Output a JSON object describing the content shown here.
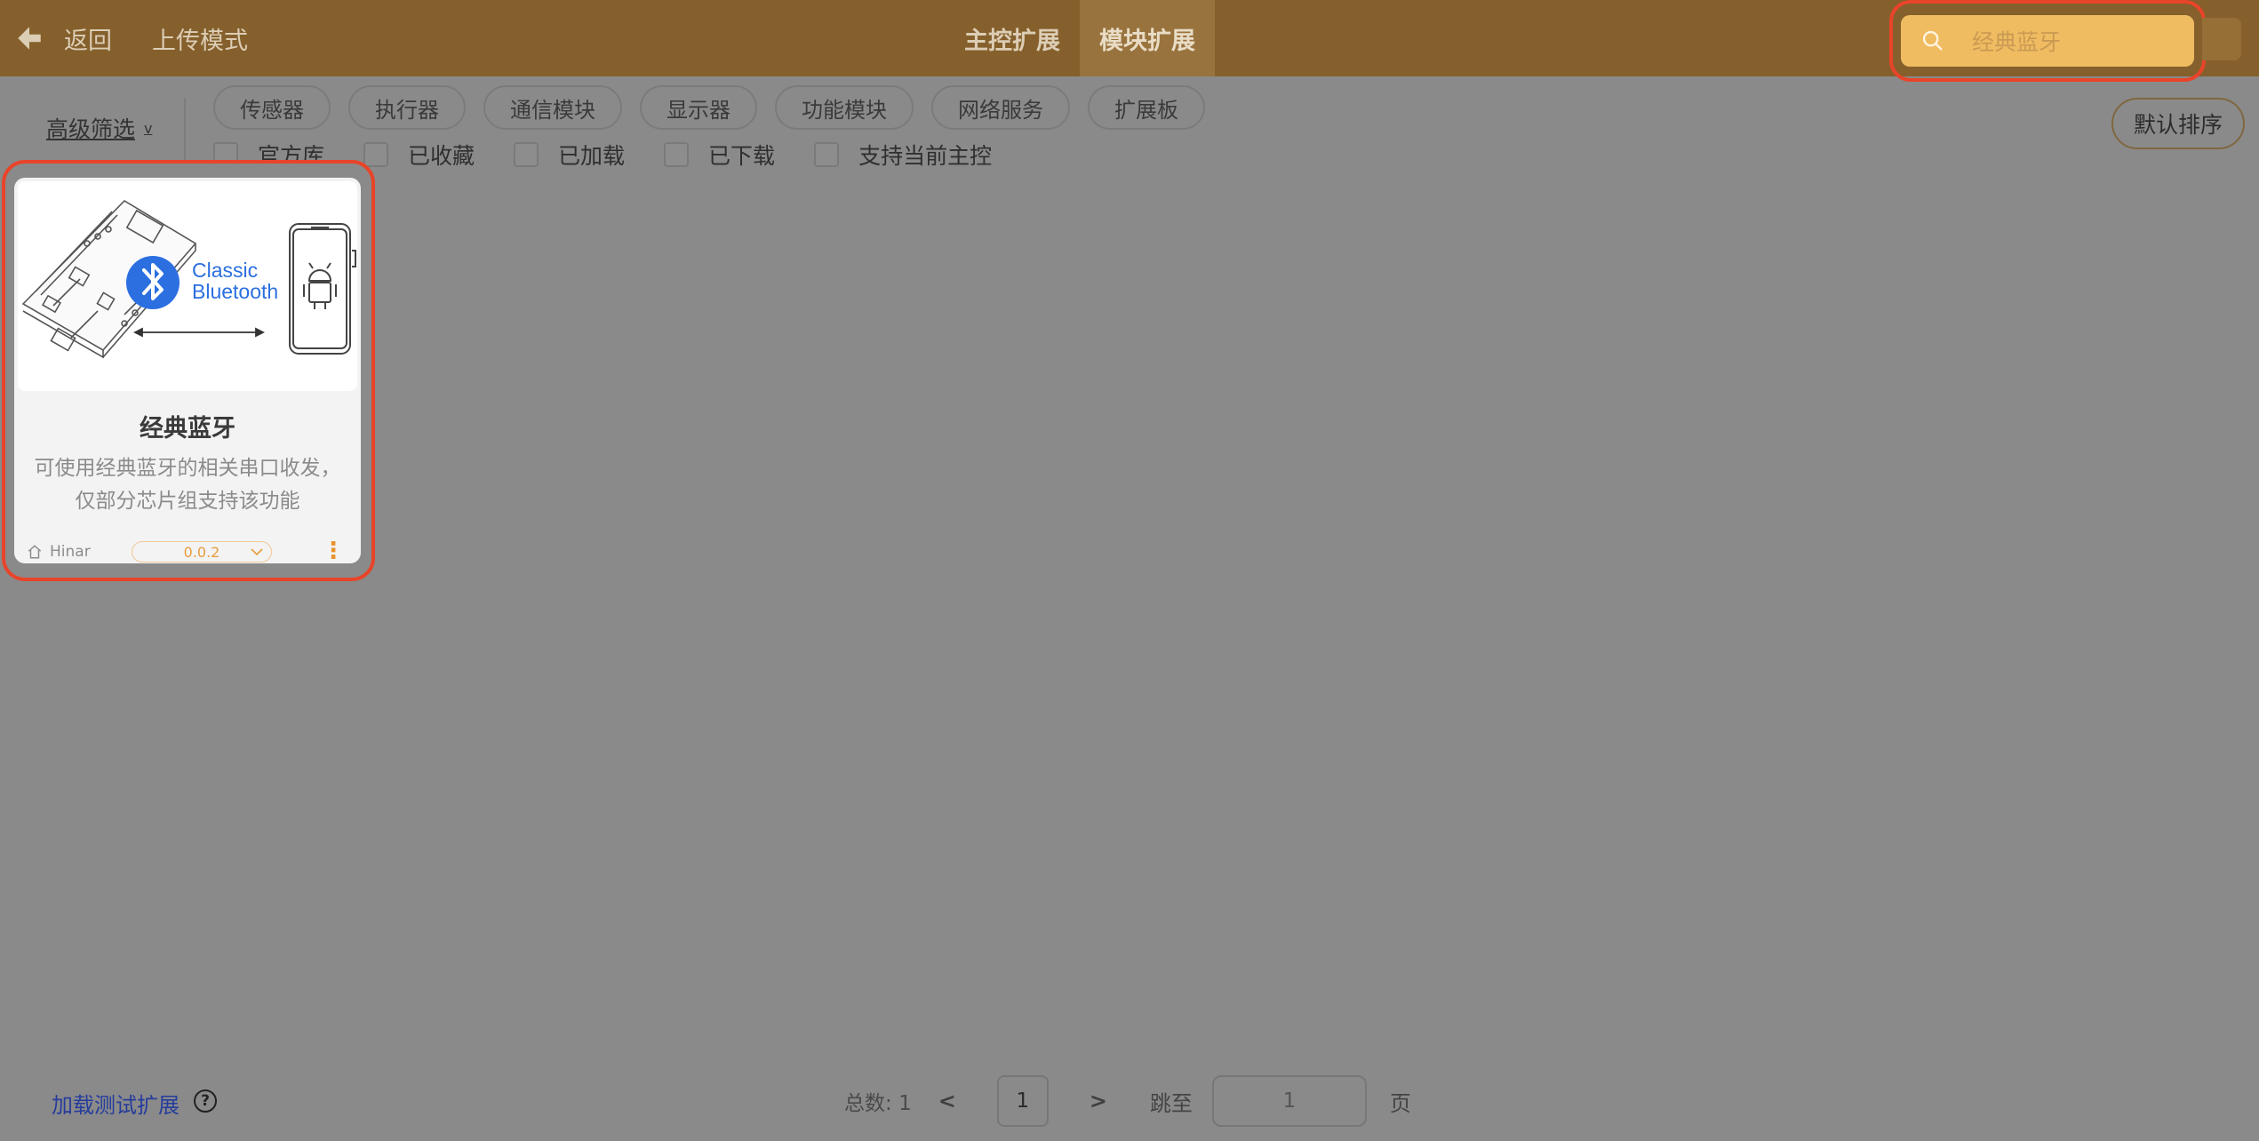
{
  "header": {
    "back_label": "返回",
    "upload_mode_label": "上传模式",
    "tabs": [
      {
        "label": "主控扩展",
        "active": false
      },
      {
        "label": "模块扩展",
        "active": true
      }
    ],
    "search": {
      "value": "经典蓝牙",
      "placeholder": ""
    }
  },
  "filters": {
    "advanced_label": "高级筛选",
    "categories": [
      "传感器",
      "执行器",
      "通信模块",
      "显示器",
      "功能模块",
      "网络服务",
      "扩展板"
    ],
    "checkboxes": [
      "官方库",
      "已收藏",
      "已加载",
      "已下载",
      "支持当前主控"
    ],
    "sort_label": "默认排序"
  },
  "cards": [
    {
      "title": "经典蓝牙",
      "description": "可使用经典蓝牙的相关串口收发，仅部分芯片组支持该功能",
      "author": "Hinar",
      "version": "0.0.2",
      "image_text": {
        "line1": "Classic",
        "line2": "Bluetooth"
      }
    }
  ],
  "footer": {
    "load_test_label": "加载测试扩展",
    "help_glyph": "?",
    "total_label": "总数:",
    "total_value": "1",
    "prev_label": "<",
    "next_label": ">",
    "current_page": "1",
    "jump_label": "跳至",
    "jump_value": "1",
    "page_suffix": "页"
  },
  "colors": {
    "header_bg": "#85602c",
    "active_tab_bg": "#99733d",
    "search_bg": "#f0bc62",
    "highlight": "#e8442a",
    "bluetooth_blue": "#2b6fe0"
  }
}
